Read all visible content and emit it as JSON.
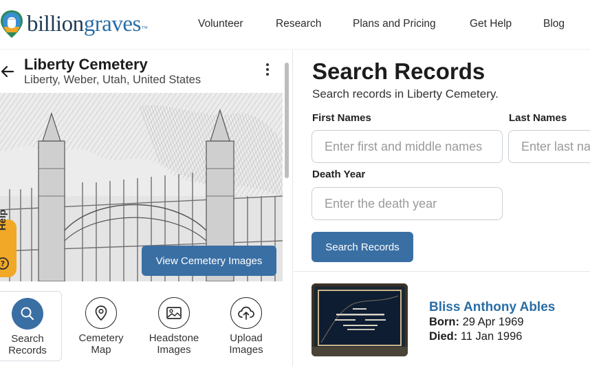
{
  "header": {
    "logo": {
      "part1": "billion",
      "part2": "graves",
      "tm": "™"
    },
    "nav": [
      {
        "label": "Volunteer"
      },
      {
        "label": "Research"
      },
      {
        "label": "Plans and Pricing"
      },
      {
        "label": "Get Help"
      },
      {
        "label": "Blog"
      }
    ]
  },
  "cemetery": {
    "name": "Liberty Cemetery",
    "location": "Liberty, Weber, Utah, United States",
    "view_images_label": "View Cemetery Images",
    "help_label": "Help"
  },
  "actions": [
    {
      "line1": "Search",
      "line2": "Records",
      "icon": "search-icon"
    },
    {
      "line1": "Cemetery",
      "line2": "Map",
      "icon": "map-pin-icon"
    },
    {
      "line1": "Headstone",
      "line2": "Images",
      "icon": "image-icon"
    },
    {
      "line1": "Upload",
      "line2": "Images",
      "icon": "cloud-upload-icon"
    }
  ],
  "search": {
    "title": "Search Records",
    "subtitle": "Search records in Liberty Cemetery.",
    "first_names_label": "First Names",
    "first_names_placeholder": "Enter first and middle names",
    "last_names_label": "Last Names",
    "last_names_placeholder": "Enter last name",
    "death_year_label": "Death Year",
    "death_year_placeholder": "Enter the death year",
    "button_label": "Search Records"
  },
  "results": [
    {
      "name": "Bliss Anthony Ables",
      "born_label": "Born:",
      "born": "29 Apr 1969",
      "died_label": "Died:",
      "died": "11 Jan 1996"
    }
  ],
  "colors": {
    "accent": "#3a6fa4",
    "link": "#2a6ea6",
    "help_tab": "#f0a826"
  }
}
